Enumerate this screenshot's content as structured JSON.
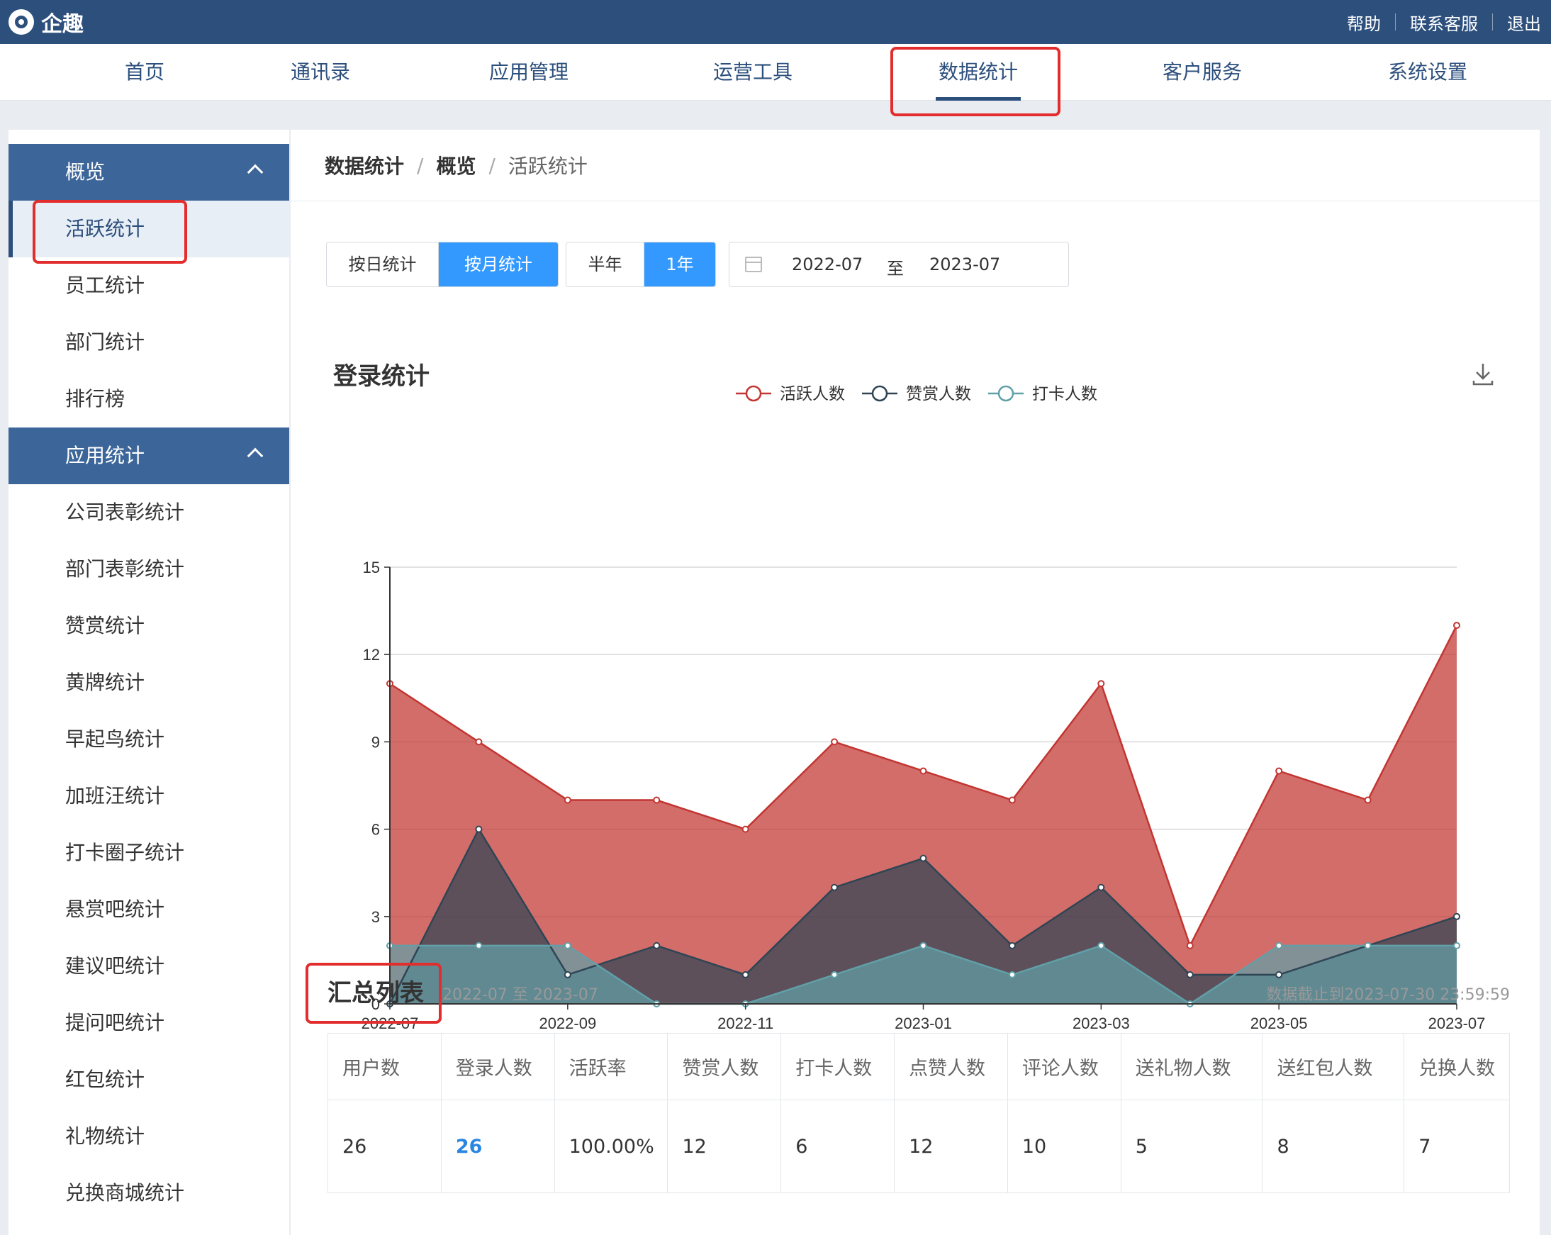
{
  "app": {
    "name": "企趣"
  },
  "top_links": [
    "帮助",
    "联系客服",
    "退出"
  ],
  "main_nav": [
    "首页",
    "通讯录",
    "应用管理",
    "运营工具",
    "数据统计",
    "客户服务",
    "系统设置"
  ],
  "sidebar": {
    "groups": [
      {
        "label": "概览",
        "items": [
          "活跃统计",
          "员工统计",
          "部门统计",
          "排行榜"
        ]
      },
      {
        "label": "应用统计",
        "items": [
          "公司表彰统计",
          "部门表彰统计",
          "赞赏统计",
          "黄牌统计",
          "早起鸟统计",
          "加班汪统计",
          "打卡圈子统计",
          "悬赏吧统计",
          "建议吧统计",
          "提问吧统计",
          "红包统计",
          "礼物统计",
          "兑换商城统计"
        ]
      }
    ]
  },
  "breadcrumb": [
    "数据统计",
    "概览",
    "活跃统计"
  ],
  "filters": {
    "mode": [
      "按日统计",
      "按月统计"
    ],
    "mode_selected": "按月统计",
    "period": [
      "半年",
      "1年"
    ],
    "period_selected": "1年",
    "date_start": "2022-07",
    "date_to": "至",
    "date_end": "2023-07"
  },
  "chart_data": {
    "type": "area",
    "title": "登录统计",
    "x": [
      "2022-07",
      "2022-08",
      "2022-09",
      "2022-10",
      "2022-11",
      "2022-12",
      "2023-01",
      "2023-02",
      "2023-03",
      "2023-04",
      "2023-05",
      "2023-06",
      "2023-07"
    ],
    "x_tick_labels": [
      "2022-07",
      "2022-09",
      "2022-11",
      "2023-01",
      "2023-03",
      "2023-05",
      "2023-07"
    ],
    "ylim": [
      0,
      15
    ],
    "yticks": [
      0,
      3,
      6,
      9,
      12,
      15
    ],
    "grid": true,
    "legend_position": "top-center",
    "series": [
      {
        "name": "活跃人数",
        "color": "#c23531",
        "values": [
          11,
          9,
          7,
          7,
          6,
          9,
          8,
          7,
          11,
          2,
          8,
          7,
          13
        ]
      },
      {
        "name": "赞赏人数",
        "color": "#2f4554",
        "values": [
          0,
          6,
          1,
          2,
          1,
          4,
          5,
          2,
          4,
          1,
          1,
          2,
          3
        ]
      },
      {
        "name": "打卡人数",
        "color": "#61a0a8",
        "values": [
          2,
          2,
          2,
          0,
          0,
          1,
          2,
          1,
          2,
          0,
          2,
          2,
          2
        ]
      }
    ]
  },
  "summary": {
    "title": "汇总列表",
    "range": "2022-07 至 2023-07",
    "as_of": "数据截止到2023-07-30 23:59:59",
    "columns": [
      "用户数",
      "登录人数",
      "活跃率",
      "赞赏人数",
      "打卡人数",
      "点赞人数",
      "评论人数",
      "送礼物人数",
      "送红包人数",
      "兑换人数"
    ],
    "row": [
      "26",
      "26",
      "100.00%",
      "12",
      "6",
      "12",
      "10",
      "5",
      "8",
      "7"
    ]
  }
}
